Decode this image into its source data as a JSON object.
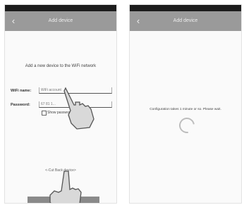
{
  "left_screen": {
    "title": "Add device",
    "back_icon": "chevron-left-icon",
    "prompt": "Add a new device to the WiFi network",
    "wifi_label": "WiFi name:",
    "wifi_value": "WiFi account",
    "password_label": "Password:",
    "password_value": "67 81 1...",
    "show_password_label": "Show password",
    "hint_text": "<-Cut   Back device>",
    "button_label": "Set the device"
  },
  "right_screen": {
    "title": "Add device",
    "back_icon": "chevron-left-icon",
    "config_text": "Configuration takes 1 minute or so. Please wait.",
    "spinner_icon": "loading-spinner-icon"
  },
  "colors": {
    "title_bar": "#9a9a9a",
    "status_bar": "#1c1c1c",
    "button": "#8a8a8a"
  }
}
